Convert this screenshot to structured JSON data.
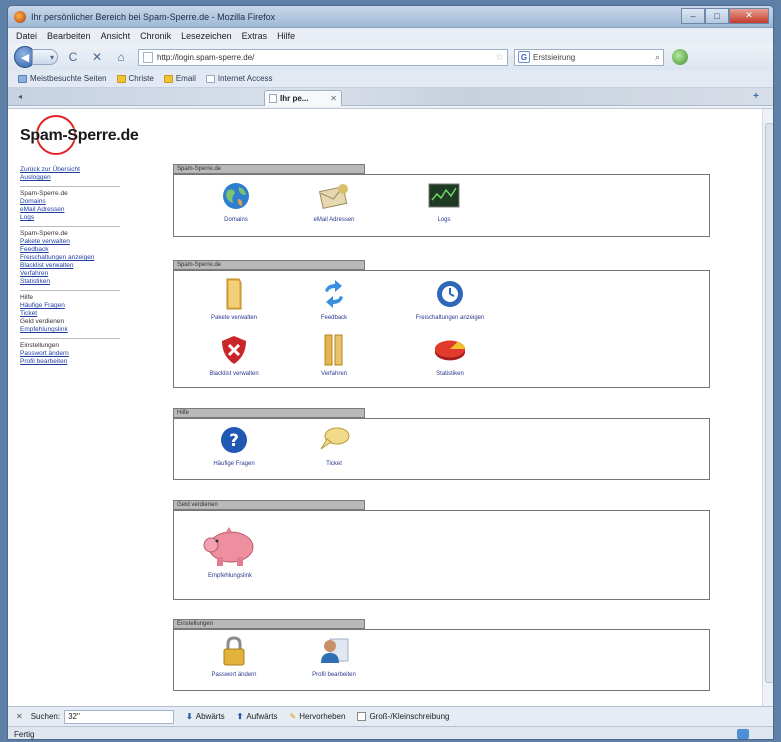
{
  "window": {
    "title": "Ihr persönlicher Bereich bei Spam-Sperre.de - Mozilla Firefox",
    "controls": {
      "minimize": "–",
      "maximize": "□",
      "close": "✕"
    }
  },
  "menu": [
    "Datei",
    "Bearbeiten",
    "Ansicht",
    "Chronik",
    "Lesezeichen",
    "Extras",
    "Hilfe"
  ],
  "nav": {
    "back": "◀",
    "forward": "▾",
    "reload": "C",
    "stop": "✕",
    "home": "⌂",
    "url": "http://login.spam-sperre.de/",
    "search_engine": "G",
    "search_placeholder": "Erstsieirung"
  },
  "bookmarks": [
    "Meistbesuchte Seiten",
    "Christe",
    "Email",
    "Internet Access"
  ],
  "tab": {
    "title": "Ihr pe...",
    "close": "✕",
    "new": "+"
  },
  "site": {
    "logo": "Spam-Sperre.de",
    "sidebar": [
      {
        "links": [
          "Zurück zur Übersicht",
          "Ausloggen"
        ]
      },
      {
        "head": "Spam-Sperre.de",
        "links": [
          "Domains",
          "eMail Adressen",
          "Logs"
        ]
      },
      {
        "head": "Spam-Sperre.de",
        "links": [
          "Pakete verwalten",
          "Feedback",
          "Freischaltungen anzeigen",
          "Blacklist verwalten",
          "Verfahren",
          "Statistiken"
        ]
      },
      {
        "head": "Hilfe",
        "links": [
          "Häufige Fragen",
          "Ticket",
          "Geld verdienen",
          "Empfehlungslink"
        ]
      },
      {
        "head": "Einstellungen",
        "links": [
          "Passwort ändern",
          "Profil bearbeiten"
        ]
      }
    ],
    "panels": [
      {
        "title": "Spam-Sperre.de",
        "items": [
          {
            "label": "Domains",
            "icon": "globe-icon"
          },
          {
            "label": "eMail Adressen",
            "icon": "mail-icon"
          },
          {
            "label": "Logs",
            "icon": "logs-icon"
          }
        ]
      },
      {
        "title": "Spam-Sperre.de",
        "items": [
          {
            "label": "Pakete verwalten",
            "icon": "folder-icon"
          },
          {
            "label": "Feedback",
            "icon": "refresh-icon"
          },
          {
            "label": "Freischaltungen anzeigen",
            "icon": "clock-icon"
          },
          {
            "label": "Blacklist verwalten",
            "icon": "shield-icon"
          },
          {
            "label": "Verfahren",
            "icon": "binder-icon"
          },
          {
            "label": "Statistiken",
            "icon": "pie-chart-icon"
          }
        ]
      },
      {
        "title": "Hilfe",
        "items": [
          {
            "label": "Häufige Fragen",
            "icon": "help-icon"
          },
          {
            "label": "Ticket",
            "icon": "speech-bubble-icon"
          }
        ]
      },
      {
        "title": "Geld verdienen",
        "items": [
          {
            "label": "Empfehlungslink",
            "icon": "piggy-bank-icon"
          }
        ]
      },
      {
        "title": "Einstellungen",
        "items": [
          {
            "label": "Passwort ändern",
            "icon": "lock-icon"
          },
          {
            "label": "Profil bearbeiten",
            "icon": "user-icon"
          }
        ]
      }
    ]
  },
  "findbar": {
    "close": "✕",
    "label": "Suchen:",
    "value": "32\"",
    "down": "Abwärts",
    "up": "Aufwärts",
    "highlight": "Hervorheben",
    "case": "Groß-/Kleinschreibung"
  },
  "status": {
    "text": "Fertig"
  },
  "colors": {
    "link": "#1f3fa0",
    "logo_ring": "#e02424",
    "panel_header": "#b9b9b9"
  }
}
